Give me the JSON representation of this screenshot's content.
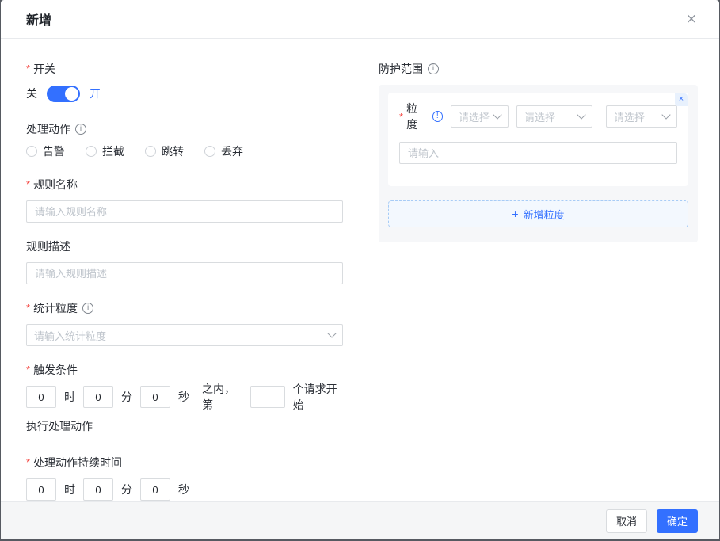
{
  "ui": {
    "required_marker": "*",
    "info_glyph": "i",
    "alert_glyph": "!",
    "close_glyph": "×",
    "card_close_glyph": "×",
    "plus_glyph": "+"
  },
  "colors": {
    "primary": "#3370ff",
    "required_red": "#f54a45",
    "placeholder": "#bfc5cc",
    "input_border": "#d9dcdf",
    "panel_bg": "#f6f7f9",
    "footer_bg": "#f5f6f7",
    "add_button_bg": "#f3f8fe",
    "add_button_border": "#a8ccf6",
    "card_close_badge_bg": "#e8f1fd"
  },
  "modal": {
    "title": "新增"
  },
  "units": {
    "hour": "时",
    "minute": "分",
    "second": "秒"
  },
  "form": {
    "switch": {
      "label": "开关",
      "off_label": "关",
      "on_label": "开",
      "state": "on"
    },
    "action": {
      "label": "处理动作",
      "options": [
        "告警",
        "拦截",
        "跳转",
        "丢弃"
      ]
    },
    "rule_name": {
      "label": "规则名称",
      "placeholder": "请输入规则名称",
      "value": ""
    },
    "rule_desc": {
      "label": "规则描述",
      "placeholder": "请输入规则描述",
      "value": ""
    },
    "stat_granularity": {
      "label": "统计粒度",
      "placeholder": "请输入统计粒度",
      "value": ""
    },
    "trigger": {
      "label": "触发条件",
      "hours": "0",
      "minutes": "0",
      "seconds": "0",
      "within_text": "之内，第",
      "request_count": "",
      "after_text": "个请求开始",
      "line2": "执行处理动作"
    },
    "duration": {
      "label": "处理动作持续时间",
      "hours": "0",
      "minutes": "0",
      "seconds": "0"
    }
  },
  "protection": {
    "label": "防护范围",
    "granularity_label": "粒度",
    "select_placeholders": [
      "请选择",
      "请选择",
      "请选择"
    ],
    "input_placeholder": "请输入",
    "input_value": "",
    "add_label": "新增粒度"
  },
  "footer": {
    "cancel": "取消",
    "confirm": "确定"
  }
}
